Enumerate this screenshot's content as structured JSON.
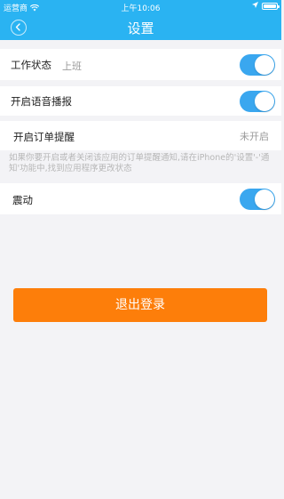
{
  "status_bar": {
    "carrier": "运营商",
    "time": "上午10:06",
    "battery_level": 1.0
  },
  "nav": {
    "title": "设置",
    "back_icon": "chevron-left-icon"
  },
  "settings": {
    "work_status": {
      "label": "工作状态",
      "value": "上班",
      "enabled": true
    },
    "voice_broadcast": {
      "label": "开启语音播报",
      "enabled": true
    },
    "order_reminder": {
      "label": "开启订单提醒",
      "value": "未开启"
    },
    "hint": "如果你要开启或者关闭该应用的订单提醒通知,请在iPhone的'设置'-'通知'功能中,找到应用程序更改状态",
    "vibrate": {
      "label": "震动",
      "enabled": true
    }
  },
  "logout": {
    "label": "退出登录"
  },
  "colors": {
    "header": "#2ab3f2",
    "toggle_on": "#3aa7ef",
    "logout": "#fd7e0a",
    "background": "#f3f3f6"
  }
}
